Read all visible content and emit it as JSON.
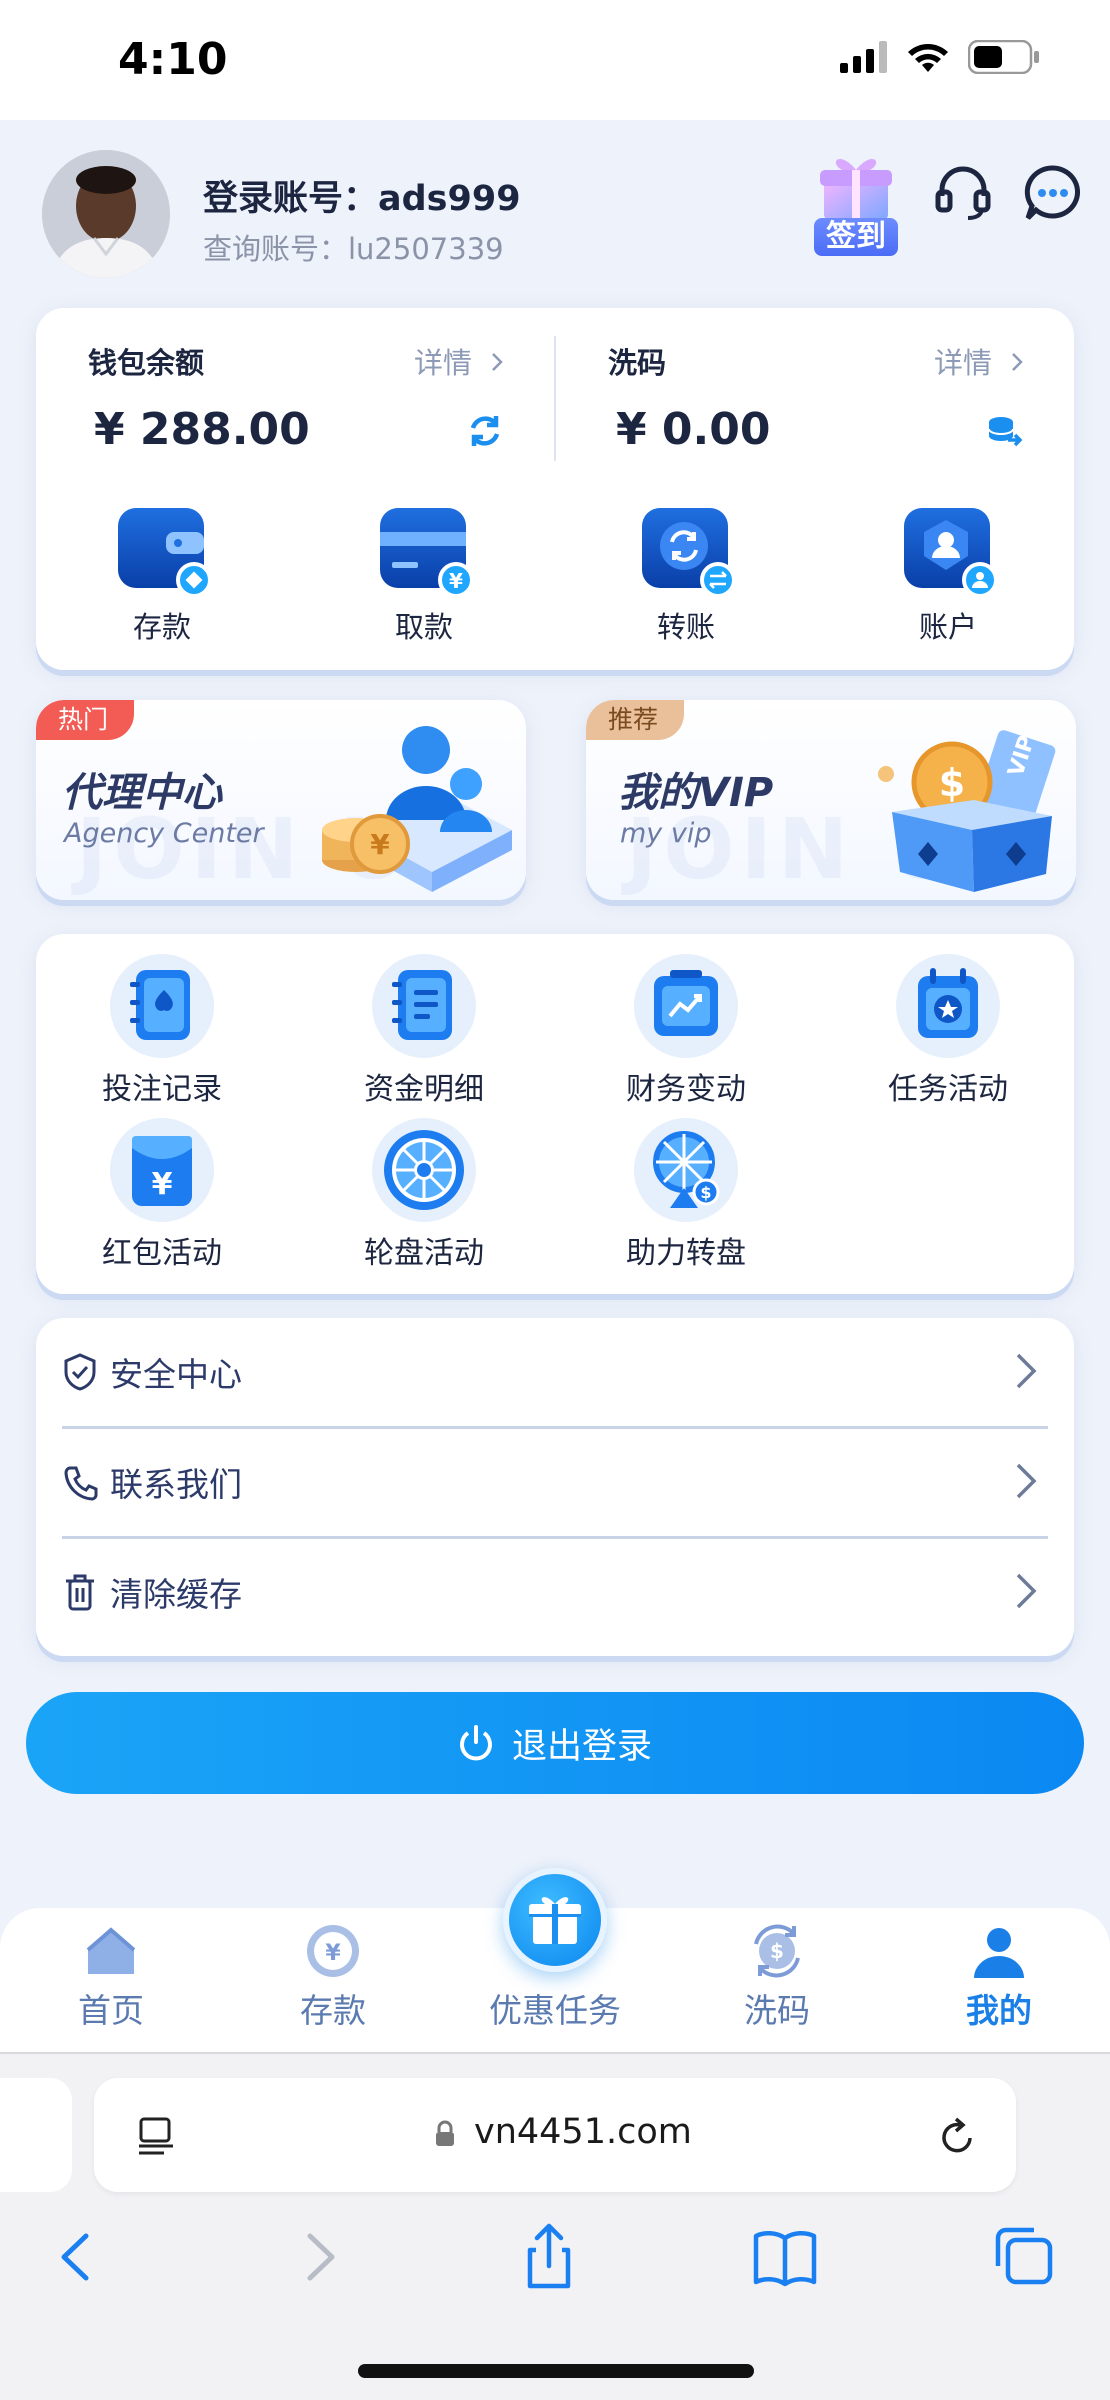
{
  "status_bar": {
    "time": "4:10"
  },
  "header": {
    "account_label": "登录账号：ads999",
    "query_label": "查询账号：lu2507339",
    "signin_label": "签到"
  },
  "wallet": {
    "balance_label": "钱包余额",
    "balance_detail": "详情",
    "balance_amount": "¥ 288.00",
    "wash_label": "洗码",
    "wash_detail": "详情",
    "wash_amount": "¥ 0.00",
    "actions": [
      {
        "label": "存款",
        "icon": "wallet-deposit-icon"
      },
      {
        "label": "取款",
        "icon": "card-withdraw-icon"
      },
      {
        "label": "转账",
        "icon": "transfer-icon"
      },
      {
        "label": "账户",
        "icon": "account-icon"
      }
    ]
  },
  "promos": [
    {
      "badge": "热门",
      "title": "代理中心",
      "subtitle": "Agency Center",
      "watermark": "JOIN US"
    },
    {
      "badge": "推荐",
      "title": "我的VIP",
      "subtitle": "my vip",
      "watermark": "JOIN US"
    }
  ],
  "features": [
    {
      "label": "投注记录",
      "icon": "bet-record-icon"
    },
    {
      "label": "资金明细",
      "icon": "fund-detail-icon"
    },
    {
      "label": "财务变动",
      "icon": "finance-change-icon"
    },
    {
      "label": "任务活动",
      "icon": "task-activity-icon"
    },
    {
      "label": "红包活动",
      "icon": "red-envelope-icon"
    },
    {
      "label": "轮盘活动",
      "icon": "roulette-icon"
    },
    {
      "label": "助力转盘",
      "icon": "assist-wheel-icon"
    }
  ],
  "menu": [
    {
      "label": "安全中心",
      "icon": "shield-icon"
    },
    {
      "label": "联系我们",
      "icon": "phone-icon"
    },
    {
      "label": "清除缓存",
      "icon": "trash-icon"
    }
  ],
  "logout_label": "退出登录",
  "tabbar": [
    {
      "label": "首页",
      "icon": "home-icon",
      "active": false
    },
    {
      "label": "存款",
      "icon": "deposit-icon",
      "active": false
    },
    {
      "label": "优惠任务",
      "icon": "gift-icon",
      "active": false
    },
    {
      "label": "洗码",
      "icon": "wash-icon",
      "active": false
    },
    {
      "label": "我的",
      "icon": "user-icon",
      "active": true
    }
  ],
  "browser": {
    "url": "vn4451.com"
  },
  "colors": {
    "accent": "#0b88f2",
    "hot_badge": "#f25c54",
    "recommend_badge": "#e8b88a",
    "text_primary": "#1d2640"
  }
}
